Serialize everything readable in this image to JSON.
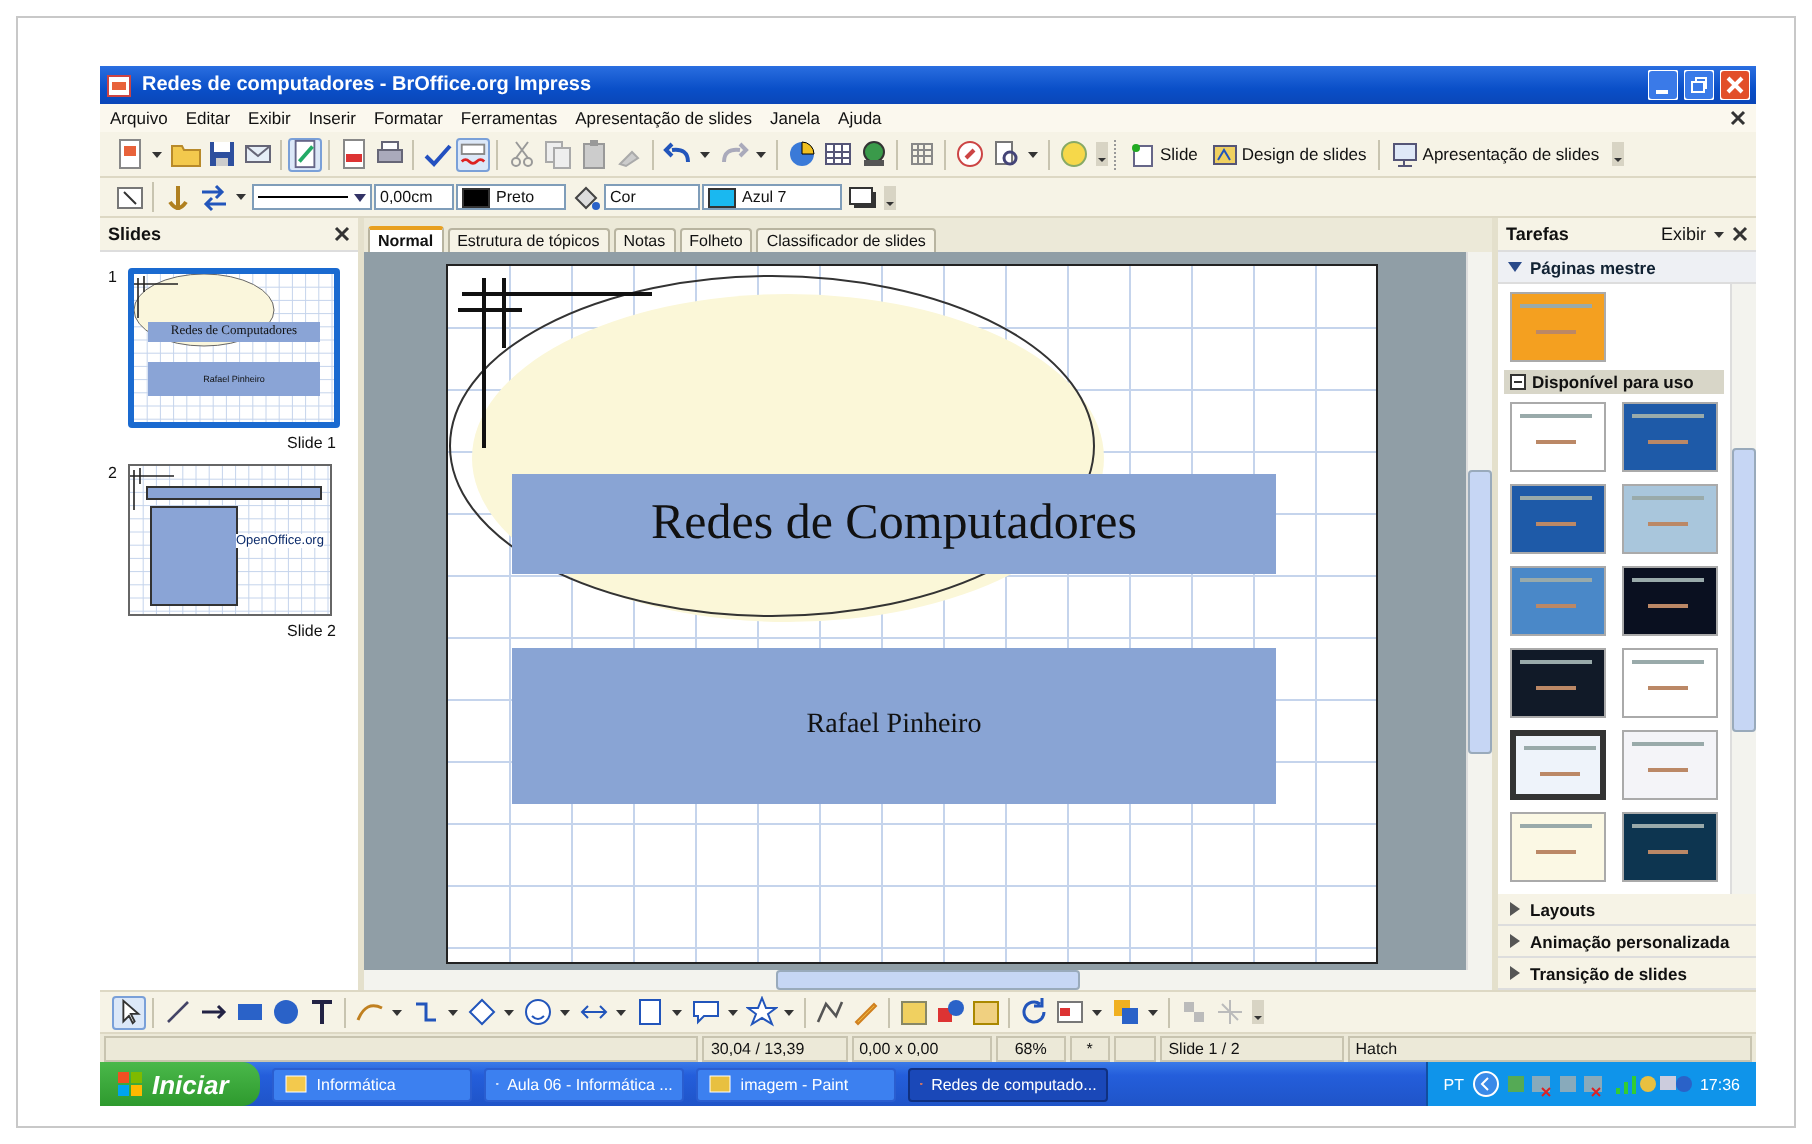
{
  "window": {
    "title": "Redes de computadores - BrOffice.org Impress"
  },
  "menu": [
    "Arquivo",
    "Editar",
    "Exibir",
    "Inserir",
    "Formatar",
    "Ferramentas",
    "Apresentação de slides",
    "Janela",
    "Ajuda"
  ],
  "standard_toolbar": {
    "edit_file_on": true,
    "auto_spellcheck_on": true,
    "buttons": [
      "Slide",
      "Design de slides",
      "Apresentação de slides"
    ]
  },
  "line_toolbar": {
    "line_width": "0,00cm",
    "line_color": {
      "value": "Preto",
      "color": "#000000"
    },
    "area_style": "Cor",
    "area_color": {
      "value": "Azul 7",
      "color": "#1ab8f0"
    }
  },
  "slides_panel": {
    "title": "Slides",
    "thumbnails": [
      {
        "number": "1",
        "label": "Slide 1",
        "selected": true,
        "kind": "title",
        "title": "Redes de Computadores",
        "subtitle": "Rafael Pinheiro"
      },
      {
        "number": "2",
        "label": "Slide 2",
        "selected": false,
        "kind": "content",
        "logo": "OpenOffice.org"
      }
    ]
  },
  "view_tabs": [
    {
      "label": "Normal",
      "selected": true
    },
    {
      "label": "Estrutura de tópicos",
      "selected": false
    },
    {
      "label": "Notas",
      "selected": false
    },
    {
      "label": "Folheto",
      "selected": false
    },
    {
      "label": "Classificador de slides",
      "selected": false
    }
  ],
  "slide": {
    "title": "Redes de Computadores",
    "subtitle": "Rafael Pinheiro"
  },
  "tasks_pane": {
    "title": "Tarefas",
    "menu": "Exibir",
    "sections": [
      {
        "title": "Páginas mestre",
        "expanded": true,
        "used_masters": [
          {
            "color": "#f4a020",
            "selected": false
          }
        ],
        "group": {
          "title": "Disponível para uso",
          "expanded": true,
          "masters": [
            {
              "color": "#ffffff",
              "selected": false
            },
            {
              "color": "#1e5aa8",
              "selected": false
            },
            {
              "color": "#1e5aa8",
              "selected": false
            },
            {
              "color": "#a9c6dc",
              "selected": false
            },
            {
              "color": "#4a88c8",
              "selected": false
            },
            {
              "color": "#0a1020",
              "selected": false
            },
            {
              "color": "#111a28",
              "selected": false
            },
            {
              "color": "#ffffff",
              "selected": false
            },
            {
              "color": "#eef3fa",
              "selected": true
            },
            {
              "color": "#f4f4f8",
              "selected": false
            },
            {
              "color": "#fbf8e4",
              "selected": false
            },
            {
              "color": "#0d3550",
              "selected": false
            }
          ]
        }
      },
      {
        "title": "Layouts",
        "expanded": false
      },
      {
        "title": "Animação personalizada",
        "expanded": false
      },
      {
        "title": "Transição de slides",
        "expanded": false
      }
    ]
  },
  "drawing_toolbar": {
    "select_on": true
  },
  "status_bar": {
    "position": "30,04 / 13,39",
    "size": "0,00 x 0,00",
    "zoom": "68%",
    "modified": "*",
    "page": "Slide 1 / 2",
    "style": "Hatch"
  },
  "taskbar": {
    "start": "Iniciar",
    "tasks": [
      {
        "label": "Informática",
        "selected": false
      },
      {
        "label": "Aula 06 - Informática ...",
        "selected": false
      },
      {
        "label": "imagem - Paint",
        "selected": false
      },
      {
        "label": "Redes de computado...",
        "selected": true
      }
    ],
    "language": "PT",
    "clock": "17:36"
  }
}
